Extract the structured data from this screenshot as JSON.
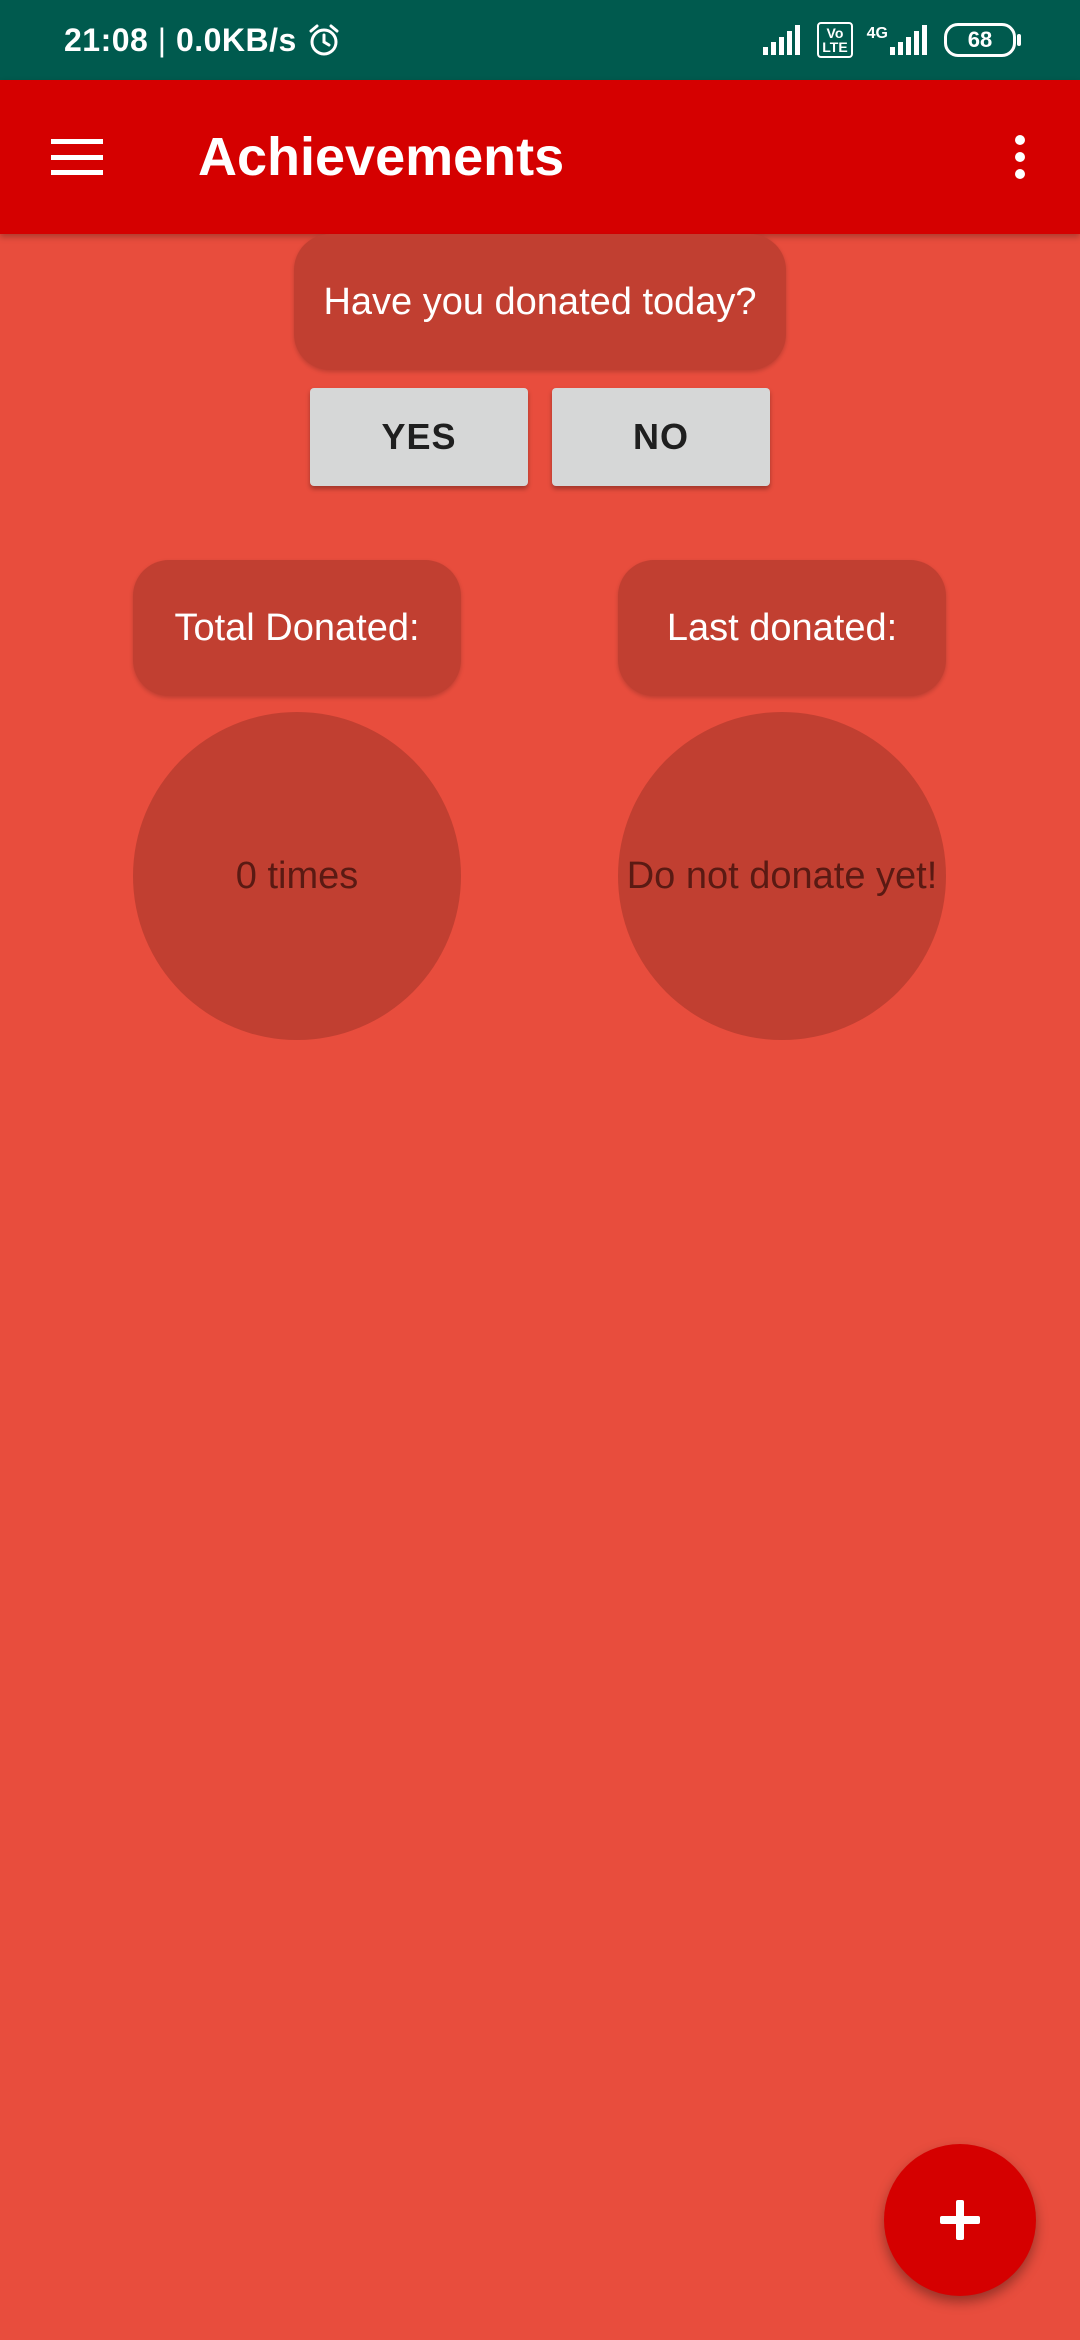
{
  "status_bar": {
    "time": "21:08",
    "separator": " | ",
    "network_speed": "0.0KB/s",
    "alarm_icon": "alarm-clock-icon",
    "signal_icon": "signal-bars-icon",
    "volte_top": "Vo",
    "volte_bottom": "LTE",
    "network_type": "4G",
    "battery_level": "68",
    "background_color": "#005a4e"
  },
  "app_bar": {
    "title": "Achievements",
    "menu_icon": "hamburger-menu-icon",
    "overflow_icon": "more-vert-icon",
    "background_color": "#d50000"
  },
  "question": {
    "text": "Have you donated today?"
  },
  "buttons": {
    "yes_label": "YES",
    "no_label": "NO"
  },
  "stats": {
    "total_label": "Total Donated:",
    "total_value": "0 times",
    "last_label": "Last donated:",
    "last_value": "Do not donate yet!"
  },
  "fab": {
    "icon": "plus-icon",
    "color": "#d50000"
  },
  "page_background": "#e84d3d"
}
